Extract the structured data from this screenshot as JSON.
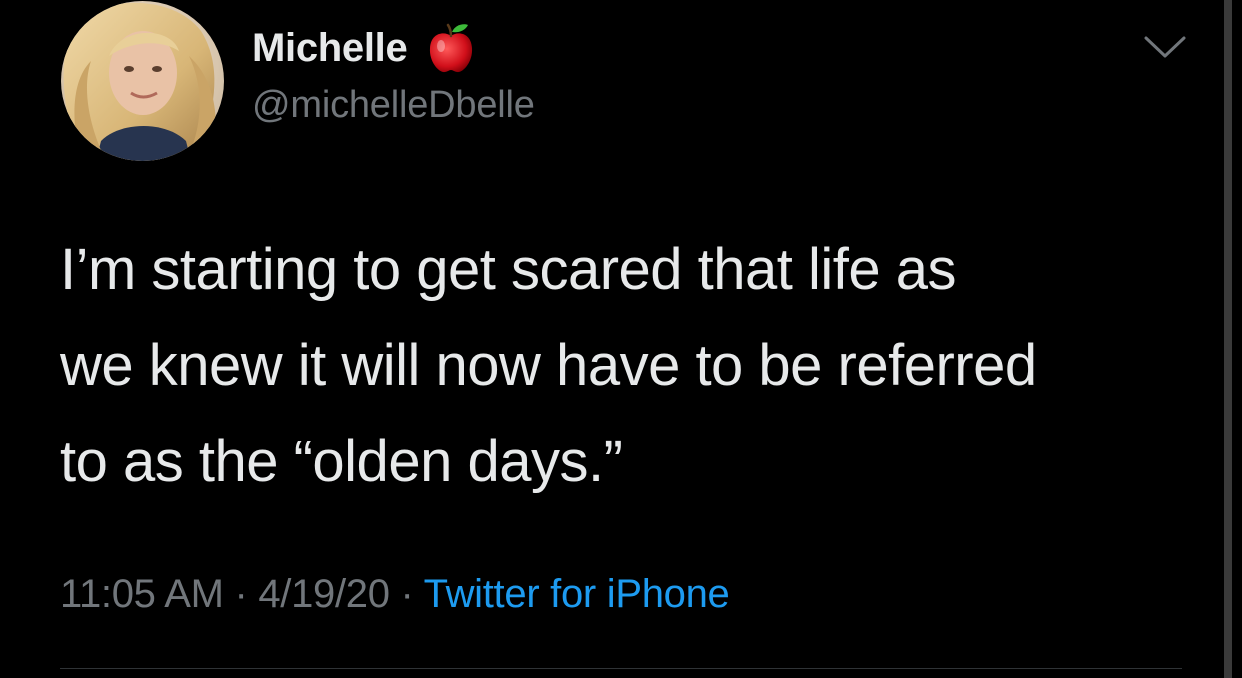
{
  "tweet": {
    "author": {
      "display_name": "Michelle",
      "handle": "@michelleDbelle",
      "name_emoji": "apple-icon"
    },
    "text": "I’m starting to get scared that life as\nwe knew it will now have to be referred\nto as the “olden days.”",
    "time": "11:05 AM",
    "date": "4/19/20",
    "separator": "·",
    "source": "Twitter for iPhone"
  },
  "colors": {
    "background": "#000000",
    "text": "#e7e9ea",
    "secondary_text": "#71767b",
    "link": "#1d9bf0",
    "divider": "#2f3336"
  },
  "icons": {
    "menu": "chevron-down-icon",
    "emoji": "apple-icon"
  }
}
